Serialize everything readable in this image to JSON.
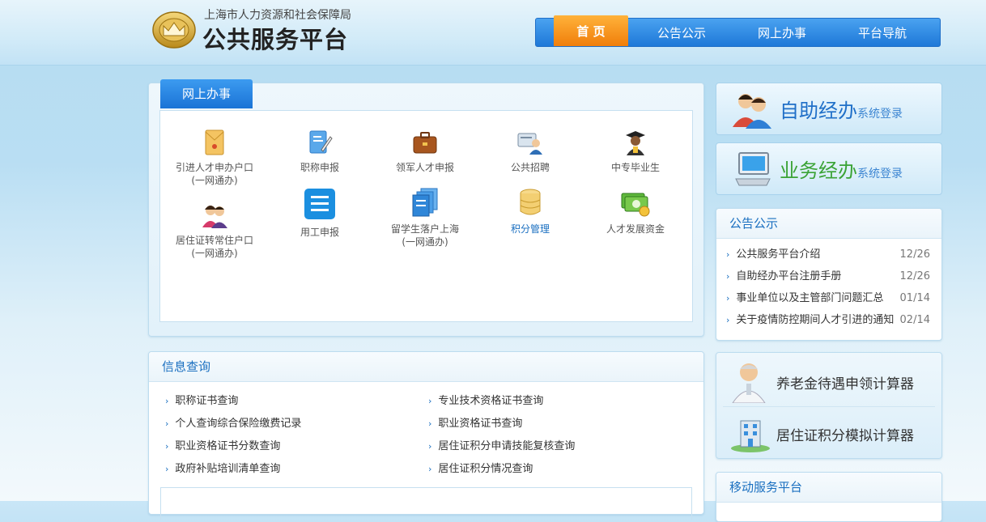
{
  "header": {
    "org_name": "上海市人力资源和社会保障局",
    "site_title": "公共服务平台",
    "nav": [
      {
        "label": "首 页",
        "active": true
      },
      {
        "label": "公告公示",
        "active": false
      },
      {
        "label": "网上办事",
        "active": false
      },
      {
        "label": "平台导航",
        "active": false
      }
    ]
  },
  "online_services": {
    "title": "网上办事",
    "items": [
      {
        "label": "引进人才申办户口\n(一网通办)",
        "icon": "envelope-icon"
      },
      {
        "label": "职称申报",
        "icon": "certificate-edit-icon"
      },
      {
        "label": "领军人才申报",
        "icon": "briefcase-icon"
      },
      {
        "label": "公共招聘",
        "icon": "recruitment-icon"
      },
      {
        "label": "中专毕业生",
        "icon": "graduate-icon"
      },
      {
        "label": "居住证转常住户口\n(一网通办)",
        "icon": "couple-icon"
      },
      {
        "label": "用工申报",
        "icon": "document-list-icon"
      },
      {
        "label": "留学生落户上海\n(一网通办)",
        "icon": "documents-stack-icon"
      },
      {
        "label": "积分管理",
        "icon": "database-icon"
      },
      {
        "label": "人才发展资金",
        "icon": "money-icon"
      }
    ]
  },
  "info_query": {
    "title": "信息查询",
    "left": [
      "职称证书查询",
      "个人查询综合保险缴费记录",
      "职业资格证书分数查询",
      "政府补贴培训清单查询"
    ],
    "right": [
      "专业技术资格证书查询",
      "职业资格证书查询",
      "居住证积分申请技能复核查询",
      "居住证积分情况查询"
    ]
  },
  "login": {
    "self_service": {
      "big": "自助经办",
      "small": "系统登录"
    },
    "business": {
      "big": "业务经办",
      "small": "系统登录"
    }
  },
  "notices": {
    "title": "公告公示",
    "items": [
      {
        "title": "公共服务平台介绍",
        "date": "12/26"
      },
      {
        "title": "自助经办平台注册手册",
        "date": "12/26"
      },
      {
        "title": "事业单位以及主管部门问题汇总",
        "date": "01/14"
      },
      {
        "title": "关于疫情防控期间人才引进的通知",
        "date": "02/14"
      }
    ]
  },
  "calculators": [
    {
      "label": "养老金待遇申领计算器",
      "icon": "elderly-person-icon"
    },
    {
      "label": "居住证积分模拟计算器",
      "icon": "building-icon"
    }
  ],
  "mobile": {
    "title": "移动服务平台"
  },
  "colors": {
    "accent": "#1a6fc0",
    "nav_active": "#f07e0a",
    "nav": "#1e78d8"
  }
}
